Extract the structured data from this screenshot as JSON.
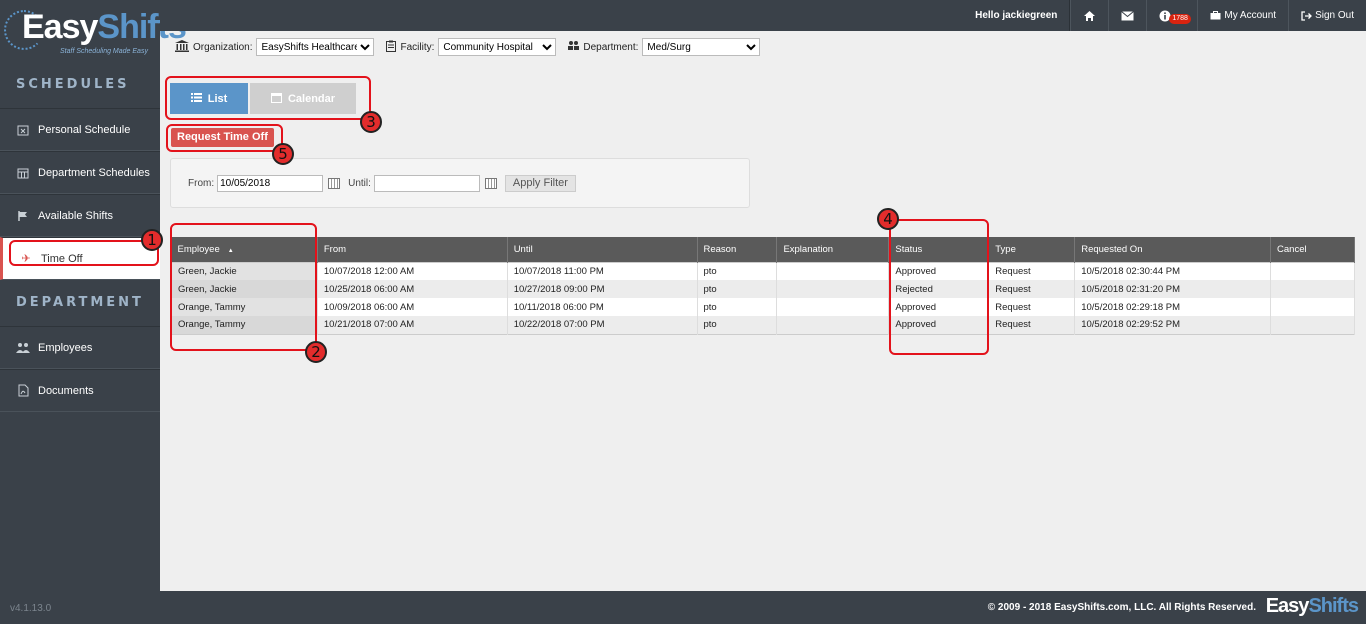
{
  "app": {
    "brand_easy": "Easy",
    "brand_shifts": "Shifts",
    "tagline": "Staff Scheduling Made Easy",
    "version": "v4.1.13.0"
  },
  "topbar": {
    "greeting": "Hello jackiegreen",
    "notif_count": "1788",
    "my_account": "My Account",
    "sign_out": "Sign Out"
  },
  "sidebar": {
    "schedules_heading": "SCHEDULES",
    "department_heading": "DEPARTMENT",
    "items": [
      {
        "label": "Personal Schedule",
        "icon": "calendar-x-icon"
      },
      {
        "label": "Department Schedules",
        "icon": "calendar-grid-icon"
      },
      {
        "label": "Available Shifts",
        "icon": "flag-icon"
      },
      {
        "label": "Time Off",
        "icon": "plane-icon"
      },
      {
        "label": "Employees",
        "icon": "users-icon"
      },
      {
        "label": "Documents",
        "icon": "pdf-icon"
      }
    ]
  },
  "filters": {
    "org_label": "Organization:",
    "org_value": "EasyShifts Healthcare",
    "facility_label": "Facility:",
    "facility_value": "Community Hospital",
    "dept_label": "Department:",
    "dept_value": "Med/Surg"
  },
  "view": {
    "list_label": "List",
    "calendar_label": "Calendar",
    "request_label": "Request Time Off"
  },
  "date_filter": {
    "from_label": "From:",
    "from_value": "10/05/2018",
    "until_label": "Until:",
    "until_value": "",
    "apply_label": "Apply Filter"
  },
  "table": {
    "headers": [
      "Employee",
      "From",
      "Until",
      "Reason",
      "Explanation",
      "Status",
      "Type",
      "Requested On",
      "Cancel"
    ],
    "rows": [
      [
        "Green, Jackie",
        "10/07/2018 12:00 AM",
        "10/07/2018 11:00 PM",
        "pto",
        "",
        "Approved",
        "Request",
        "10/5/2018 02:30:44 PM",
        ""
      ],
      [
        "Green, Jackie",
        "10/25/2018 06:00 AM",
        "10/27/2018 09:00 PM",
        "pto",
        "",
        "Rejected",
        "Request",
        "10/5/2018 02:31:20 PM",
        ""
      ],
      [
        "Orange, Tammy",
        "10/09/2018 06:00 AM",
        "10/11/2018 06:00 PM",
        "pto",
        "",
        "Approved",
        "Request",
        "10/5/2018 02:29:18 PM",
        ""
      ],
      [
        "Orange, Tammy",
        "10/21/2018 07:00 AM",
        "10/22/2018 07:00 PM",
        "pto",
        "",
        "Approved",
        "Request",
        "10/5/2018 02:29:52 PM",
        ""
      ]
    ]
  },
  "annotations": [
    "1",
    "2",
    "3",
    "4",
    "5"
  ],
  "footer": {
    "copyright": "© 2009 - 2018 EasyShifts.com, LLC. All Rights Reserved."
  },
  "colors": {
    "accent": "#5b95c9",
    "danger": "#d9534f",
    "dark": "#3a4149",
    "annotation": "#e3121b"
  }
}
